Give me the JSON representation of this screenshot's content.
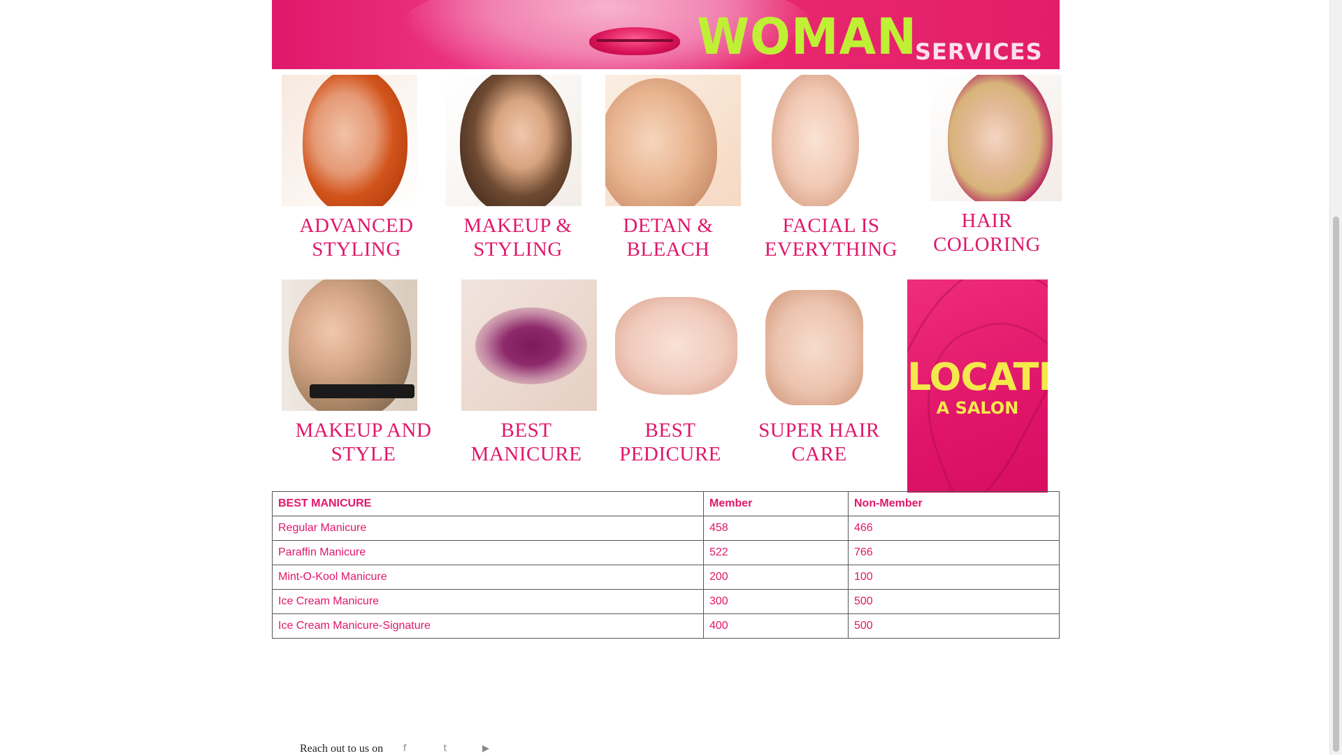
{
  "banner": {
    "title": "WOMAN",
    "subtitle": "SERVICES"
  },
  "services": [
    {
      "label": "ADVANCED\nSTYLING",
      "line1": "ADVANCED",
      "line2": "STYLING"
    },
    {
      "label": "MAKEUP & STYLING",
      "line1": "MAKEUP &",
      "line2": "STYLING"
    },
    {
      "label": "DETAN & BLEACH",
      "line1": "DETAN &",
      "line2": "BLEACH"
    },
    {
      "label": "FACIAL IS EVERYTHING",
      "line1": "FACIAL IS",
      "line2": "EVERYTHING"
    },
    {
      "label": "HAIR COLORING",
      "line1": "HAIR",
      "line2": "COLORING"
    },
    {
      "label": "MAKEUP AND STYLE",
      "line1": "MAKEUP AND",
      "line2": "STYLE"
    },
    {
      "label": "BEST MANICURE",
      "line1": "BEST",
      "line2": "MANICURE"
    },
    {
      "label": "BEST PEDICURE",
      "line1": "BEST",
      "line2": "PEDICURE"
    },
    {
      "label": "SUPER HAIR CARE",
      "line1": "SUPER HAIR",
      "line2": "CARE"
    }
  ],
  "locate": {
    "main": "LOCATE",
    "sub": "A SALON"
  },
  "table": {
    "headers": [
      "BEST MANICURE",
      "Member",
      "Non-Member"
    ],
    "rows": [
      [
        "Regular Manicure",
        "458",
        "466"
      ],
      [
        "Paraffin Manicure",
        "522",
        "766"
      ],
      [
        "Mint-O-Kool Manicure",
        "200",
        "100"
      ],
      [
        "Ice Cream Manicure",
        "300",
        "500"
      ],
      [
        "Ice Cream Manicure-Signature",
        "400",
        "500"
      ]
    ]
  },
  "footer": {
    "text": "Reach out to us on",
    "social": [
      {
        "icon": "facebook-icon",
        "glyph": "f"
      },
      {
        "icon": "twitter-icon",
        "glyph": "t"
      },
      {
        "icon": "youtube-icon",
        "glyph": "▶"
      }
    ]
  },
  "colors": {
    "accent": "#e0176a",
    "banner_title": "#bff036",
    "locate_text": "#f4e94b"
  }
}
